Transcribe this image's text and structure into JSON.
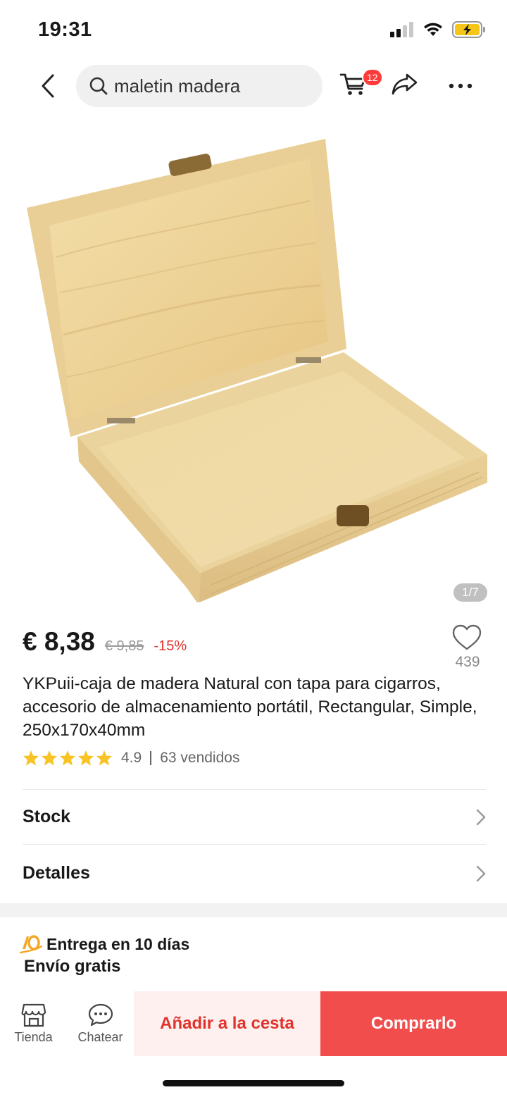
{
  "status_bar": {
    "time": "19:31",
    "icons": [
      "signal-icon",
      "wifi-icon",
      "battery-charging-icon"
    ],
    "battery_color": "#f5c518"
  },
  "nav": {
    "search_text": "maletin madera",
    "cart_badge": "12",
    "icons": [
      "back-icon",
      "search-icon",
      "cart-icon",
      "share-icon",
      "more-icon"
    ]
  },
  "gallery": {
    "counter": "1/7",
    "image_subject": "open wooden box"
  },
  "product": {
    "price": "€ 8,38",
    "original_price": "€ 9,85",
    "discount": "-15%",
    "wishlist_count": "439",
    "title": "YKPuii-caja de madera Natural con tapa para cigarros, accesorio de almacenamiento portátil, Rectangular, Simple, 250x170x40mm",
    "rating": 4.9,
    "rating_text": "4.9",
    "sold": "63 vendidos"
  },
  "rows": {
    "stock_label": "Stock",
    "details_label": "Detalles"
  },
  "delivery": {
    "days_text": "Entrega en 10 días",
    "shipping_text": "Envío gratis",
    "badge_icon": "delivery-10-icon"
  },
  "bottom_bar": {
    "store_label": "Tienda",
    "chat_label": "Chatear",
    "add_to_cart_label": "Añadir a la cesta",
    "buy_label": "Comprarlo"
  },
  "colors": {
    "accent_red": "#f24d4d",
    "discount_red": "#e0332b",
    "star_yellow": "#f7c325"
  }
}
